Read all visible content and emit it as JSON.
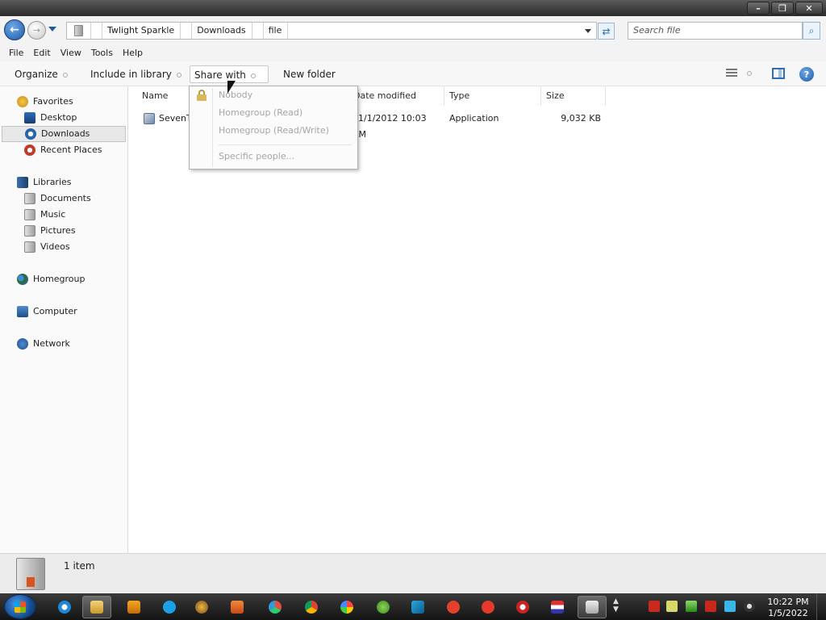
{
  "window": {
    "buttons": {
      "minimize": "–",
      "restore": "❐",
      "close": "✕"
    }
  },
  "nav": {
    "back_glyph": "←",
    "forward_glyph": "→",
    "breadcrumbs": [
      "Twlight Sparkle",
      "Downloads",
      "file"
    ],
    "refresh_glyph": "⇄",
    "search_placeholder": "Search file",
    "search_glyph": "⌕"
  },
  "menubar": {
    "items": [
      "File",
      "Edit",
      "View",
      "Tools",
      "Help"
    ]
  },
  "toolbar": {
    "organize": "Organize",
    "include_in_library": "Include in library",
    "share_with": "Share with",
    "new_folder": "New folder",
    "help_glyph": "?"
  },
  "sidebar": {
    "favorites": "Favorites",
    "desktop": "Desktop",
    "downloads": "Downloads",
    "recent_places": "Recent Places",
    "libraries": "Libraries",
    "documents": "Documents",
    "music": "Music",
    "pictures": "Pictures",
    "videos": "Videos",
    "homegroup": "Homegroup",
    "computer": "Computer",
    "network": "Network"
  },
  "columns": {
    "name": "Name",
    "date_modified": "Date modified",
    "type": "Type",
    "size": "Size"
  },
  "files": [
    {
      "name": "SevenThBrowserSetup.exe",
      "date": "11/1/2012 10:03 AM",
      "type": "Application",
      "size": "9,032 KB"
    }
  ],
  "share_menu": {
    "nobody": "Nobody",
    "homegroup_read": "Homegroup (Read)",
    "homegroup_readwrite": "Homegroup (Read/Write)",
    "specific_people": "Specific people..."
  },
  "status": {
    "count": "1 item"
  },
  "taskbar": {
    "time": "10:22 PM",
    "date": "1/5/2022"
  },
  "colors": {
    "accent": "#1f5aa8",
    "taskbar": "#1c1c1c",
    "selection": "#e8e8e8"
  }
}
